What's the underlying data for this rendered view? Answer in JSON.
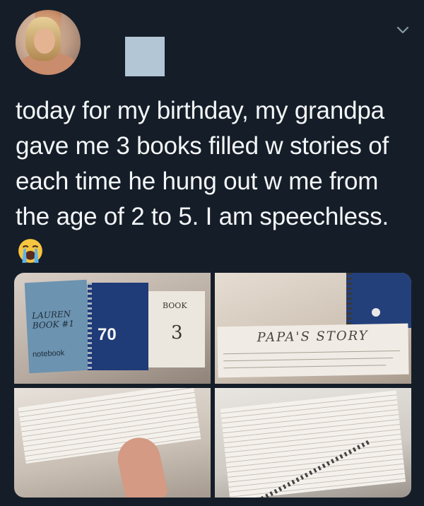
{
  "tweet": {
    "text": "today for my birthday, my grandpa gave me 3 books filled w stories of each time he hung out w me from the age of 2 to 5. I am speechless.",
    "emoji": "loudly-crying-face"
  },
  "photos": [
    {
      "book1_title": "LAUREN BOOK #1",
      "book1_brand": "notebook",
      "book2_label": "70",
      "book3_title": "BOOK",
      "book3_number": "3"
    },
    {
      "paper_title": "PAPA'S STORY"
    },
    {},
    {}
  ],
  "colors": {
    "background": "#151e28",
    "text": "#f4f6f8",
    "name_placeholder": "#b3c6d6"
  }
}
